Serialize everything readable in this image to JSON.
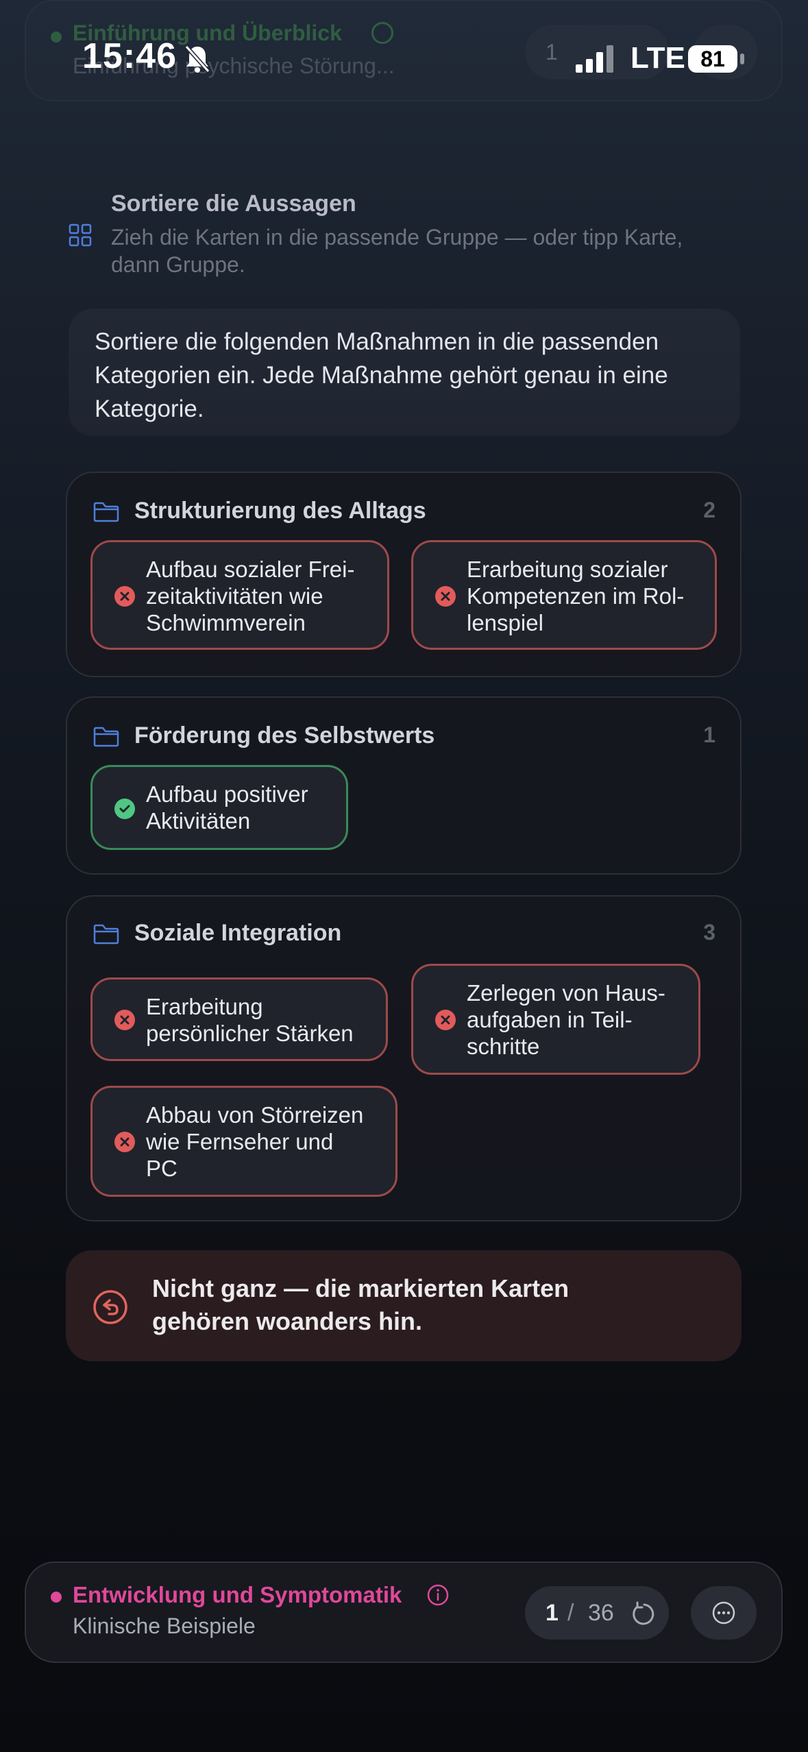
{
  "status_bar": {
    "time": "15:46",
    "network": "LTE",
    "battery": "81"
  },
  "top_header": {
    "chapter": "Einführung und Überblick",
    "subtitle": "Einführung psychische Störung...",
    "progress_current": "1",
    "progress_total": "36"
  },
  "instruction": {
    "title": "Sortiere die Aussagen",
    "subtitle": "Zieh die Karten in die passende Gruppe — oder tipp Karte, dann Gruppe."
  },
  "question": "Sortiere die folgenden Maßnahmen in die passenden Kategorien ein. Jede Maßnahme gehört genau in eine Kategorie.",
  "categories": [
    {
      "name": "Strukturierung des Alltags",
      "count": "2",
      "cards": [
        {
          "line1": "Aufbau sozialer Frei-",
          "line2": "zeitaktivitäten wie",
          "line3": "Schwimmverein",
          "status": "wrong"
        },
        {
          "line1": "Erarbeitung sozialer",
          "line2": "Kompetenzen im Rol-",
          "line3": "lenspiel",
          "status": "wrong"
        }
      ]
    },
    {
      "name": "Förderung des Selbstwerts",
      "count": "1",
      "cards": [
        {
          "line1": "Aufbau positiver",
          "line2": "Aktivitäten",
          "status": "correct"
        }
      ]
    },
    {
      "name": "Soziale Integration",
      "count": "3",
      "cards": [
        {
          "line1": "Erarbeitung",
          "line2": "persönlicher Stärken",
          "status": "wrong"
        },
        {
          "line1": "Zerlegen von Haus-",
          "line2": "aufgaben in Teil-",
          "line3": "schritte",
          "status": "wrong"
        },
        {
          "line1": "Abbau von Störreizen",
          "line2": "wie Fernseher und",
          "line3": "PC",
          "status": "wrong"
        }
      ]
    }
  ],
  "feedback": {
    "line1": "Nicht ganz — die markierten Karten",
    "line2": "gehören woanders hin."
  },
  "bottom_bar": {
    "chapter": "Entwicklung und Symptomatik",
    "subtitle": "Klinische Beispiele",
    "progress_current": "1",
    "progress_separator": "/",
    "progress_total": "36"
  },
  "colors": {
    "accent_pink": "#e0489a",
    "correct_green": "#4fc784",
    "wrong_red": "#e25b5b",
    "category_icon_blue": "#4f7fd9"
  }
}
